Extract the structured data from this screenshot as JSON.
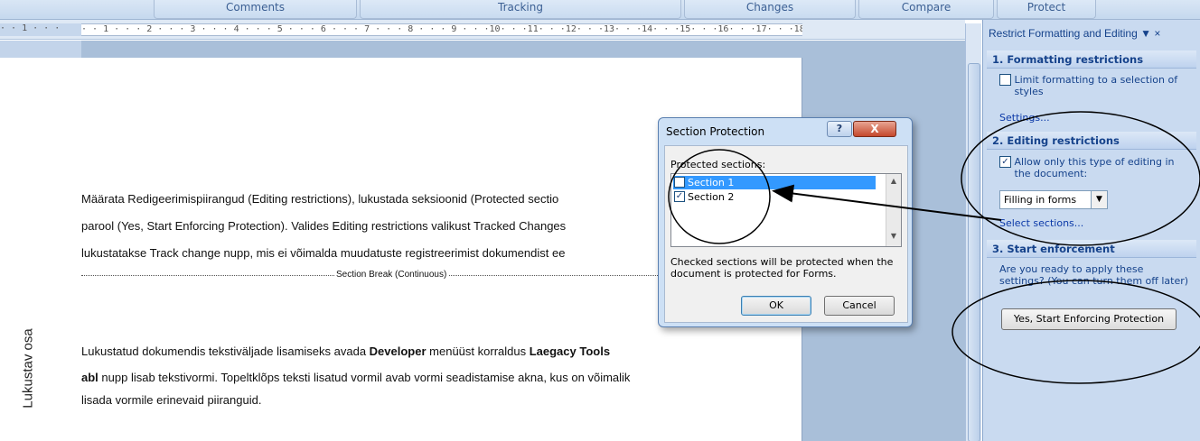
{
  "ribbon": {
    "groups": [
      "Comments",
      "Tracking",
      "Changes",
      "Compare",
      "Protect"
    ]
  },
  "ruler": {
    "left_marks": "· · 1 · · ·",
    "marks": "· · 1 · · · 2 · · · 3 · · · 4 · · · 5 · · · 6 · · · 7 · · · 8 · · · 9 · · ·10· · ·11· · ·12· · ·13· · ·14· · ·15· · ·16· · ·17· · ·18"
  },
  "document": {
    "para1_line1": "Määrata Redigeerimispiirangud (Editing restrictions), lukustada seksioonid (Protected sectio",
    "para1_line2": "parool (Yes, Start Enforcing Protection). Valides Editing restrictions valikust Tracked Changes",
    "para1_line3": "lukustatakse Track change nupp, mis ei võimalda muudatuste registreerimist dokumendist ee",
    "section_break": "Section Break (Continuous)",
    "side_label": "Lukustav osa",
    "para2_line1_a": "Lukustatud dokumendis tekstiväljade lisamiseks avada ",
    "para2_line1_b": "Developer",
    "para2_line1_c": " menüüst korraldus ",
    "para2_line1_d": "Laegacy Tools",
    "para2_line2_a": "abl",
    "para2_line2_b": " nupp lisab tekstivormi. Topeltklõps teksti lisatud vormil avab vormi seadistamise akna, kus on võimalik",
    "para2_line3": "lisada vormile erinevaid piiranguid."
  },
  "dialog": {
    "title": "Section Protection",
    "help": "?",
    "close": "X",
    "label": "Protected sections:",
    "sections": [
      {
        "label": "Section 1",
        "checked": false,
        "selected": true
      },
      {
        "label": "Section 2",
        "checked": true,
        "selected": false
      }
    ],
    "note": "Checked sections will be protected when the document is protected for Forms.",
    "ok": "OK",
    "cancel": "Cancel"
  },
  "pane": {
    "title": "Restrict Formatting and Editing",
    "h1": "1. Formatting restrictions",
    "limit_formatting": "Limit formatting to a selection of styles",
    "settings_link": "Settings...",
    "h2": "2. Editing restrictions",
    "allow_only": "Allow only this type of editing in the document:",
    "editing_type": "Filling in forms",
    "select_sections_link": "Select sections...",
    "h3": "3. Start enforcement",
    "ready_text": "Are you ready to apply these settings? (You can turn them off later)",
    "enforce_button": "Yes, Start Enforcing Protection"
  },
  "colors": {
    "pane_bg": "#c9daf0",
    "pane_text": "#15428b",
    "selection": "#3399ff",
    "close_button": "#c5482c"
  }
}
